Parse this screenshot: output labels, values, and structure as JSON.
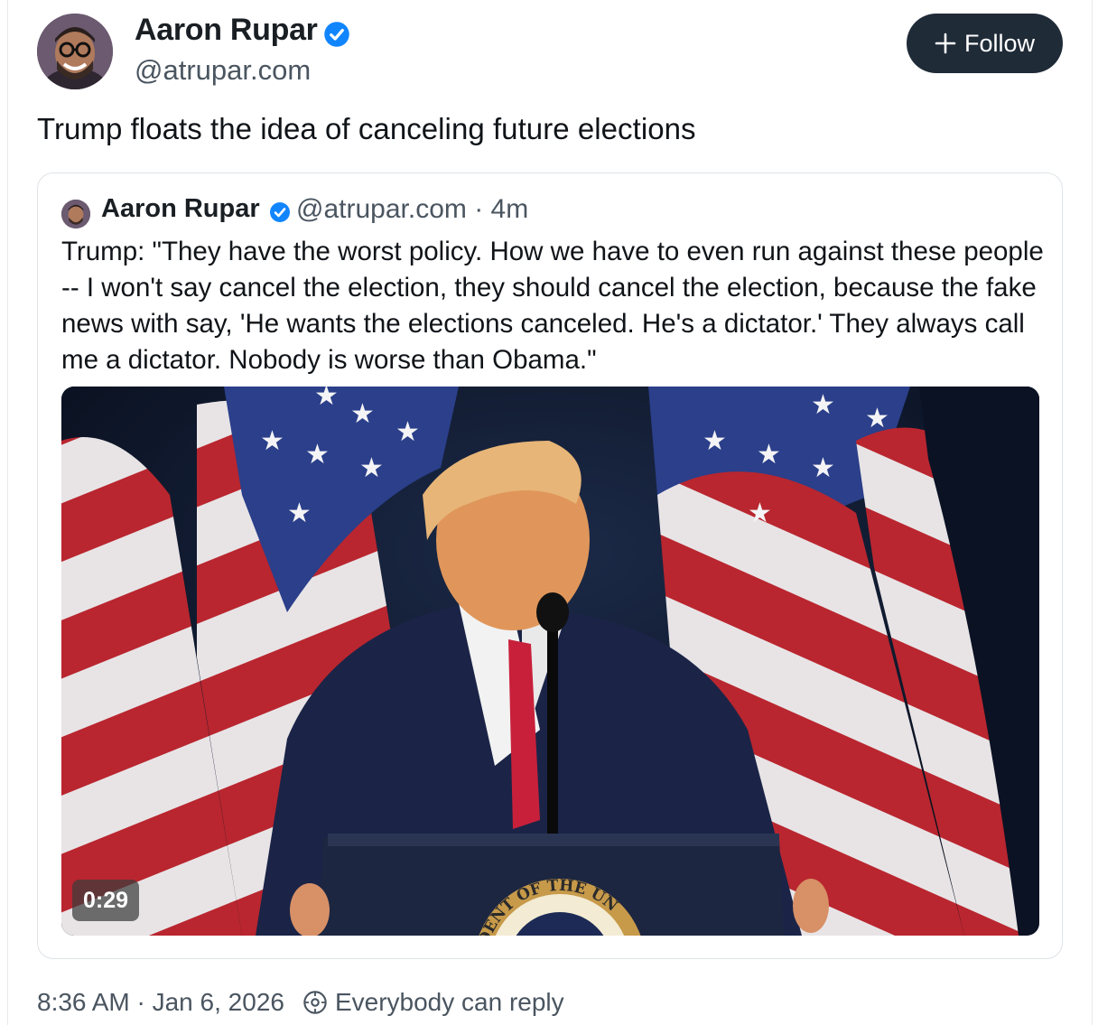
{
  "author": {
    "name": "Aaron Rupar",
    "handle": "@atrupar.com"
  },
  "follow_button": {
    "label": "Follow"
  },
  "post": {
    "text": "Trump floats the idea of canceling future elections"
  },
  "quoted_post": {
    "author_name": "Aaron Rupar",
    "handle_time": "@atrupar.com · 4m",
    "text": "Trump: \"They have the worst policy. How we have to even run against these people -- I won't say cancel the election, they should cancel the election, because the fake news with say, 'He wants the elections canceled. He's a dictator.' They always call me a dictator. Nobody is worse than Obama.\"",
    "video": {
      "duration": "0:29",
      "seal_text": "SIDENT OF THE UN"
    }
  },
  "footer": {
    "timestamp": "8:36 AM · Jan 6, 2026",
    "reply_setting": "Everybody can reply"
  },
  "colors": {
    "verified": "#1185fe",
    "follow_bg": "#1f2b37",
    "secondary_text": "#4a5560"
  },
  "icons": {
    "verified": "verified-badge-icon",
    "follow": "plus-icon",
    "reply": "reply-restriction-icon"
  }
}
